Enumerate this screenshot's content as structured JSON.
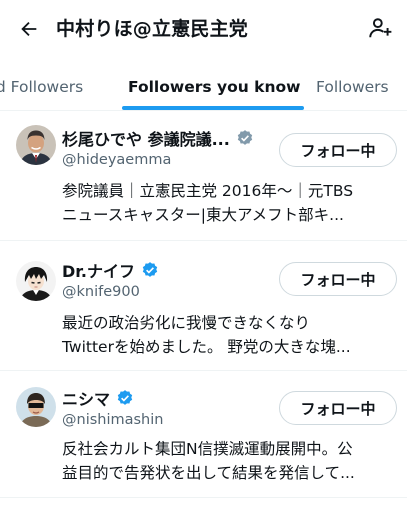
{
  "header": {
    "title": "中村りほ@立憲民主党",
    "back_icon": "arrow-left-icon",
    "add_icon": "add-person-icon"
  },
  "tabs": [
    {
      "label": "ied Followers",
      "active": false
    },
    {
      "label": "Followers you know",
      "active": true
    },
    {
      "label": "Followers",
      "active": false
    }
  ],
  "accent_color": "#1d9bf0",
  "users": [
    {
      "name": "杉尾ひでや 参議院議...",
      "handle": "@hideyaemma",
      "verified": "gray",
      "follow_label": "フォロー中",
      "bio_line1": "参院議員｜立憲民主党 2016年〜｜元TBS",
      "bio_line2": "ニュースキャスター|東大アメフト部キ..."
    },
    {
      "name": "Dr.ナイフ",
      "handle": "@knife900",
      "verified": "blue",
      "follow_label": "フォロー中",
      "bio_line1": "最近の政治劣化に我慢できなくなり",
      "bio_line2": "Twitterを始めました。 野党の大きな塊..."
    },
    {
      "name": "ニシマ",
      "handle": "@nishimashin",
      "verified": "blue",
      "follow_label": "フォロー中",
      "bio_line1": "反社会カルト集団N信撲滅運動展開中。公",
      "bio_line2": "益目的で告発状を出して結果を発信して..."
    }
  ]
}
